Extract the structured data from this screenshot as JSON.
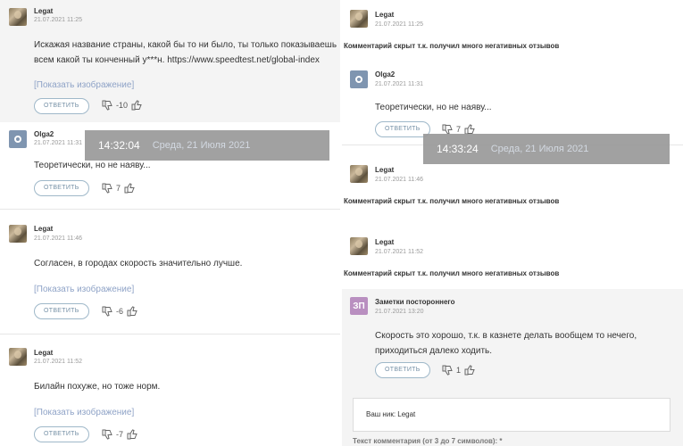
{
  "left": {
    "comments": [
      {
        "author": "Legat",
        "date": "21.07.2021 11:25",
        "text": [
          "Искажая название страны, какой бы то ни было, ты только показываешь",
          "всем какой ты конченный у***н. https://www.speedtest.net/global-index"
        ],
        "image_link": "[Показать изображение]",
        "reply": "ОТВЕТИТЬ",
        "score": "-10"
      },
      {
        "author": "Olga2",
        "date": "21.07.2021 11:31",
        "text": [
          "Теоретически, но не наяву..."
        ],
        "reply": "ОТВЕТИТЬ",
        "score": "7"
      },
      {
        "author": "Legat",
        "date": "21.07.2021 11:46",
        "text": [
          "Согласен, в городах скорость значительно лучше."
        ],
        "image_link": "[Показать изображение]",
        "reply": "ОТВЕТИТЬ",
        "score": "-6"
      },
      {
        "author": "Legat",
        "date": "21.07.2021 11:52",
        "text": [
          "Билайн похуже, но тоже норм."
        ],
        "image_link": "[Показать изображение]",
        "reply": "ОТВЕТИТЬ",
        "score": "-7"
      }
    ],
    "overlay": {
      "time": "14:32:04",
      "day": "Среда, 21 Июля 2021"
    }
  },
  "right": {
    "comments": [
      {
        "author": "Legat",
        "date": "21.07.2021 11:25",
        "hidden": "Комментарий скрыт т.к. получил много негативных отзывов"
      },
      {
        "author": "Olga2",
        "date": "21.07.2021 11:31",
        "text": [
          "Теоретически, но не наяву..."
        ],
        "reply": "ОТВЕТИТЬ",
        "score": "7"
      },
      {
        "author": "Legat",
        "date": "21.07.2021 11:46",
        "hidden": "Комментарий скрыт т.к. получил много негативных отзывов"
      },
      {
        "author": "Legat",
        "date": "21.07.2021 11:52",
        "hidden": "Комментарий скрыт т.к. получил много негативных отзывов"
      },
      {
        "author": "Заметки постороннего",
        "avatar_initials": "ЗП",
        "date": "21.07.2021 13:20",
        "text": [
          "Скорость это хорошо, т.к. в казнете делать вообщем то нечего,",
          "приходиться далеко ходить."
        ],
        "reply": "ОТВЕТИТЬ",
        "score": "1"
      }
    ],
    "overlay": {
      "time": "14:33:24",
      "day": "Среда, 21 Июля 2021"
    },
    "nick_label": "Ваш ник: Legat",
    "comment_text_label": "Текст комментария (от 3 до 7 символов): *"
  },
  "colors": {
    "link": "#8fa3c7",
    "reply_border": "#9fb8c9",
    "overlay": "#9a9a9a",
    "shaded": "#f4f4f4"
  }
}
